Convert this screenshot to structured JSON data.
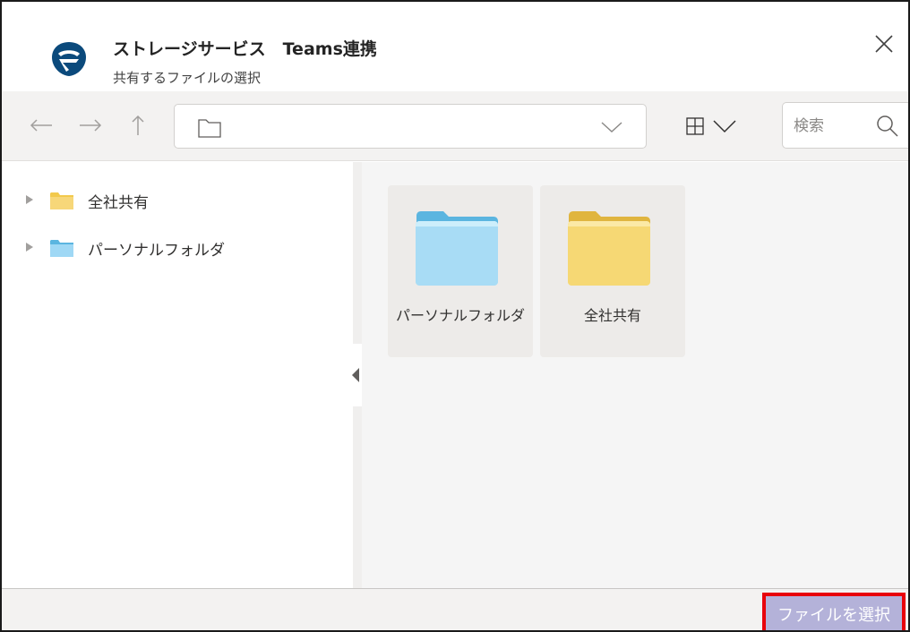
{
  "header": {
    "title": "ストレージサービス　Teams連携",
    "subtitle": "共有するファイルの選択",
    "logo_icon": "app-logo-icon",
    "brand_color": "#0b4a7c"
  },
  "toolbar": {
    "back_icon": "←",
    "forward_icon": "→",
    "up_icon": "↑",
    "path_value": "",
    "search_placeholder": "検索"
  },
  "tree": {
    "items": [
      {
        "label": "全社共有",
        "folder_color": "#f2c94c"
      },
      {
        "label": "パーソナルフォルダ",
        "folder_color": "#7cc7ea"
      }
    ]
  },
  "content": {
    "tiles": [
      {
        "label": "パーソナルフォルダ",
        "folder_color": "#9fd8f5"
      },
      {
        "label": "全社共有",
        "folder_color": "#f7d779"
      }
    ]
  },
  "footer": {
    "select_button_label": "ファイルを選択",
    "highlight_color": "#e8000b"
  }
}
